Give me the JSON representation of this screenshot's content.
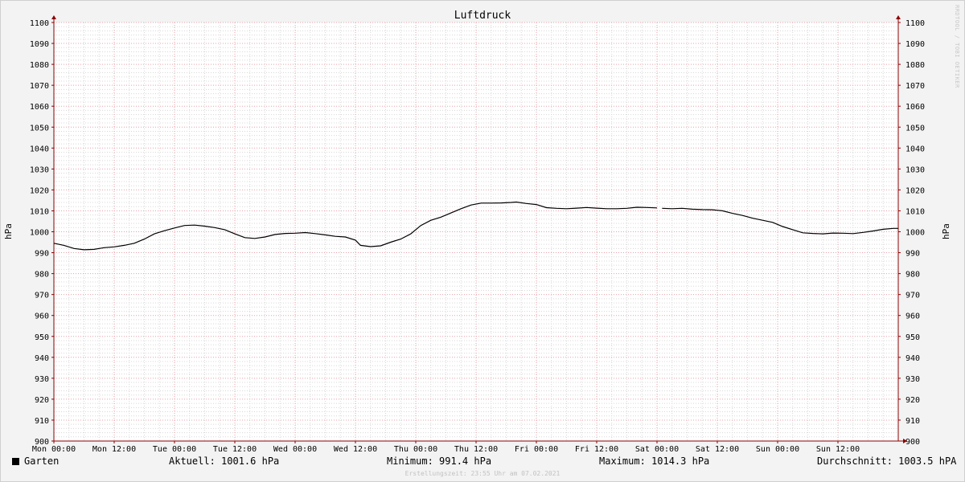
{
  "chart_data": {
    "type": "line",
    "title": "Luftdruck",
    "ylabel_left": "hPa",
    "ylabel_right": "hPa",
    "ylim": [
      900,
      1100
    ],
    "y_ticks": [
      900,
      910,
      920,
      930,
      940,
      950,
      960,
      970,
      980,
      990,
      1000,
      1010,
      1020,
      1030,
      1040,
      1050,
      1060,
      1070,
      1080,
      1090,
      1100
    ],
    "xlim_hours": [
      0,
      168
    ],
    "x_ticks": [
      {
        "hour": 0,
        "label": "Mon 00:00"
      },
      {
        "hour": 12,
        "label": "Mon 12:00"
      },
      {
        "hour": 24,
        "label": "Tue 00:00"
      },
      {
        "hour": 36,
        "label": "Tue 12:00"
      },
      {
        "hour": 48,
        "label": "Wed 00:00"
      },
      {
        "hour": 60,
        "label": "Wed 12:00"
      },
      {
        "hour": 72,
        "label": "Thu 00:00"
      },
      {
        "hour": 84,
        "label": "Thu 12:00"
      },
      {
        "hour": 96,
        "label": "Fri 00:00"
      },
      {
        "hour": 108,
        "label": "Fri 12:00"
      },
      {
        "hour": 120,
        "label": "Sat 00:00"
      },
      {
        "hour": 132,
        "label": "Sat 12:00"
      },
      {
        "hour": 144,
        "label": "Sun 00:00"
      },
      {
        "hour": 156,
        "label": "Sun 12:00"
      }
    ],
    "grid": true,
    "series": [
      {
        "name": "Garten",
        "color": "#000000",
        "segments": [
          [
            [
              0,
              994.5
            ],
            [
              2,
              993.5
            ],
            [
              4,
              992
            ],
            [
              6,
              991.4
            ],
            [
              8,
              991.6
            ],
            [
              10,
              992.4
            ],
            [
              12,
              992.8
            ],
            [
              14,
              993.5
            ],
            [
              16,
              994.5
            ],
            [
              18,
              996.5
            ],
            [
              20,
              999
            ],
            [
              22,
              1000.5
            ],
            [
              24,
              1001.8
            ],
            [
              26,
              1003
            ],
            [
              28,
              1003.2
            ],
            [
              30,
              1002.7
            ],
            [
              32,
              1002
            ],
            [
              34,
              1001
            ],
            [
              36,
              999
            ],
            [
              38,
              997.2
            ],
            [
              40,
              996.8
            ],
            [
              42,
              997.5
            ],
            [
              44,
              998.7
            ],
            [
              46,
              999.2
            ],
            [
              48,
              999.3
            ],
            [
              50,
              999.6
            ],
            [
              52,
              999.1
            ],
            [
              54,
              998.5
            ],
            [
              56,
              997.8
            ],
            [
              58,
              997.5
            ],
            [
              60,
              996
            ],
            [
              61,
              993.5
            ],
            [
              63,
              992.9
            ],
            [
              65,
              993.3
            ],
            [
              67,
              995
            ],
            [
              69,
              996.5
            ],
            [
              71,
              999
            ],
            [
              73,
              1003
            ],
            [
              75,
              1005.5
            ],
            [
              77,
              1007
            ],
            [
              79,
              1009
            ],
            [
              81,
              1011
            ],
            [
              83,
              1012.8
            ],
            [
              85,
              1013.7
            ],
            [
              87,
              1013.7
            ],
            [
              89,
              1013.8
            ],
            [
              91,
              1014
            ],
            [
              92,
              1014.2
            ],
            [
              94,
              1013.5
            ],
            [
              96,
              1013
            ],
            [
              98,
              1011.5
            ],
            [
              100,
              1011.2
            ],
            [
              102,
              1011
            ],
            [
              104,
              1011.3
            ],
            [
              106,
              1011.6
            ],
            [
              108,
              1011.3
            ],
            [
              110,
              1011
            ],
            [
              112,
              1011
            ],
            [
              114,
              1011.2
            ],
            [
              116,
              1011.7
            ],
            [
              118,
              1011.6
            ],
            [
              120,
              1011.4
            ]
          ],
          [
            [
              121,
              1011.2
            ],
            [
              123,
              1011
            ],
            [
              125,
              1011.2
            ],
            [
              127,
              1010.8
            ],
            [
              129,
              1010.6
            ],
            [
              131,
              1010.5
            ],
            [
              133,
              1010
            ],
            [
              135,
              1008.8
            ],
            [
              137,
              1007.8
            ],
            [
              139,
              1006.5
            ],
            [
              141,
              1005.5
            ],
            [
              143,
              1004.5
            ],
            [
              145,
              1002.5
            ],
            [
              147,
              1001
            ],
            [
              149,
              999.5
            ],
            [
              151,
              999.2
            ],
            [
              153,
              999
            ],
            [
              155,
              999.4
            ],
            [
              157,
              999.3
            ],
            [
              159,
              999.1
            ],
            [
              161,
              999.7
            ],
            [
              163,
              1000.4
            ],
            [
              165,
              1001.2
            ],
            [
              167,
              1001.6
            ],
            [
              168,
              1001.6
            ]
          ]
        ]
      }
    ]
  },
  "legend": {
    "series_name": "Garten",
    "current": "Aktuell: 1001.6 hPa",
    "minimum": "Minimum: 991.4 hPa",
    "maximum": "Maximum: 1014.3 hPa",
    "average": "Durchschnitt: 1003.5 hPA"
  },
  "footer": "Erstellungszeit: 23:55 Uhr am 07.02.2021",
  "watermark": "RRDTOOL / TOBI OETIKER",
  "colors": {
    "major_grid": "#e8a0a8",
    "minor_grid": "#d8d8d8",
    "axis": "#8b0000",
    "canvas": "#ffffff",
    "background": "#f3f3f3"
  }
}
